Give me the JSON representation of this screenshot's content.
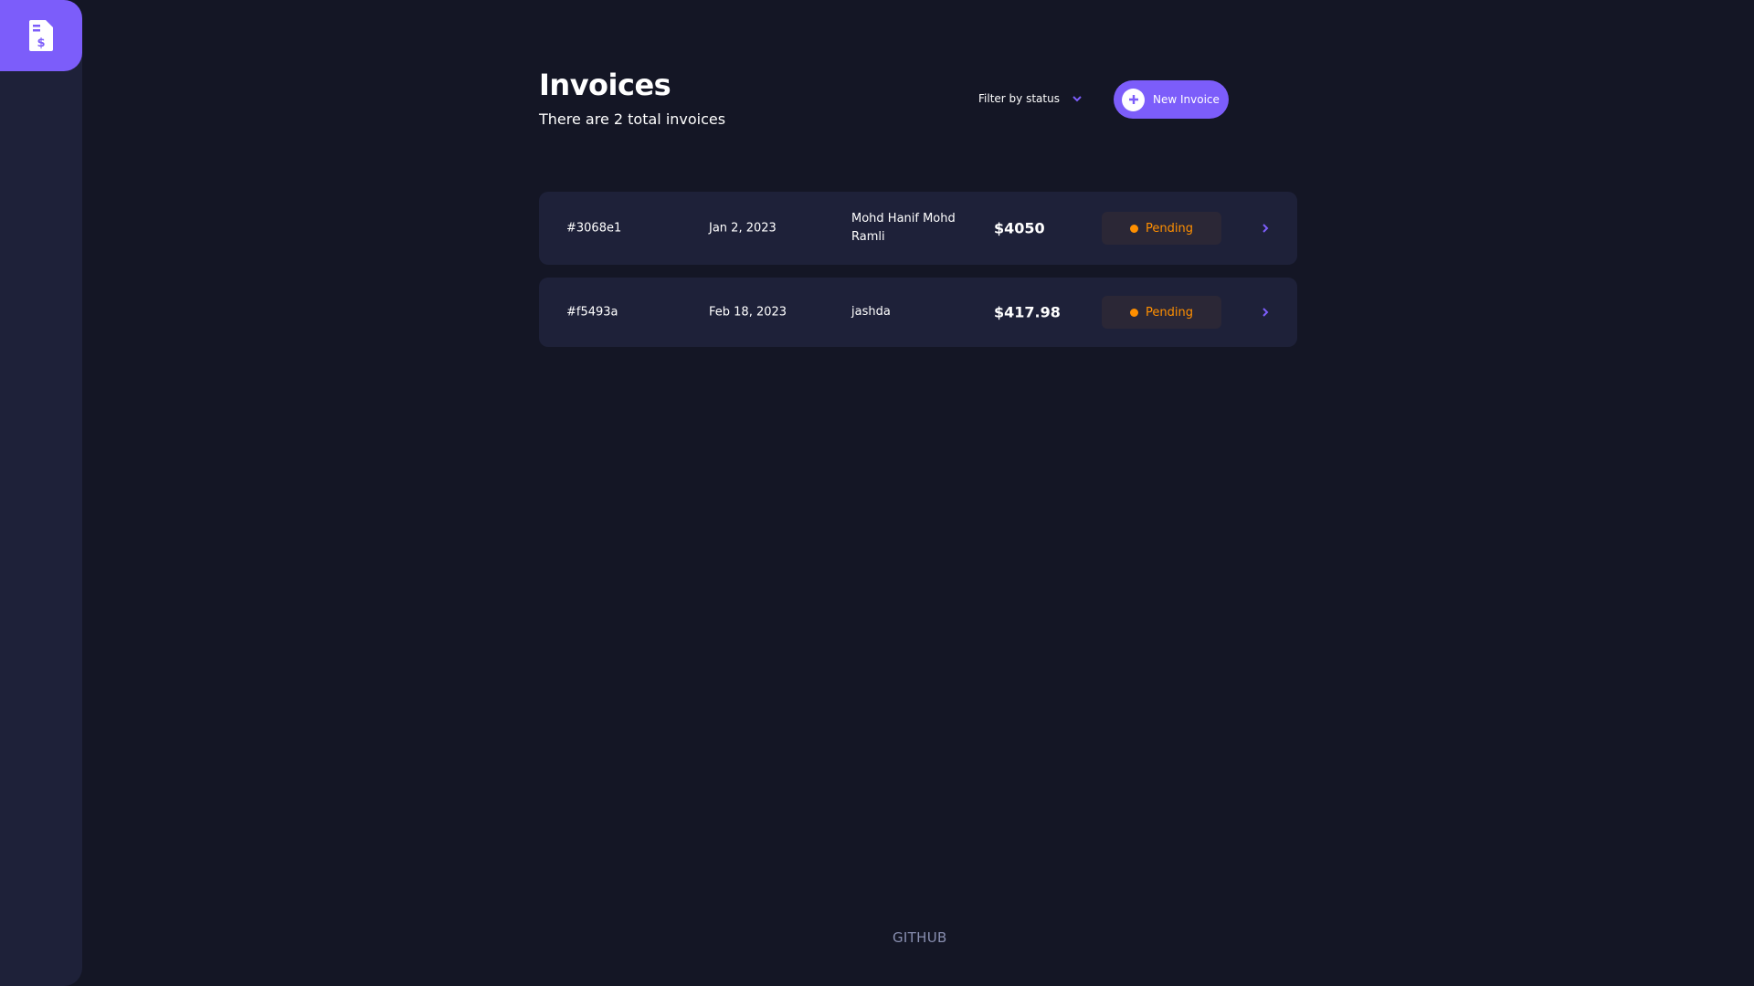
{
  "sidebar": {
    "logo_icon": "invoice-dollar-icon",
    "accent_color": "#7c5dfa"
  },
  "header": {
    "title": "Invoices",
    "subtitle": "There are 2 total invoices",
    "filter_label": "Filter by status",
    "filter_icon": "chevron-down-icon",
    "new_button_label": "New Invoice",
    "new_button_icon": "plus-icon"
  },
  "invoices": [
    {
      "id": "#3068e1",
      "date": "Jan 2, 2023",
      "client": "Mohd Hanif Mohd Ramli",
      "amount": "$4050",
      "status": "Pending"
    },
    {
      "id": "#f5493a",
      "date": "Feb 18, 2023",
      "client": "jashda",
      "amount": "$417.98",
      "status": "Pending"
    }
  ],
  "colors": {
    "background": "#141625",
    "card": "#1e2139",
    "pending": "#ff8f00",
    "muted": "#888eb0"
  },
  "footer": {
    "link_label": "GITHUB"
  }
}
